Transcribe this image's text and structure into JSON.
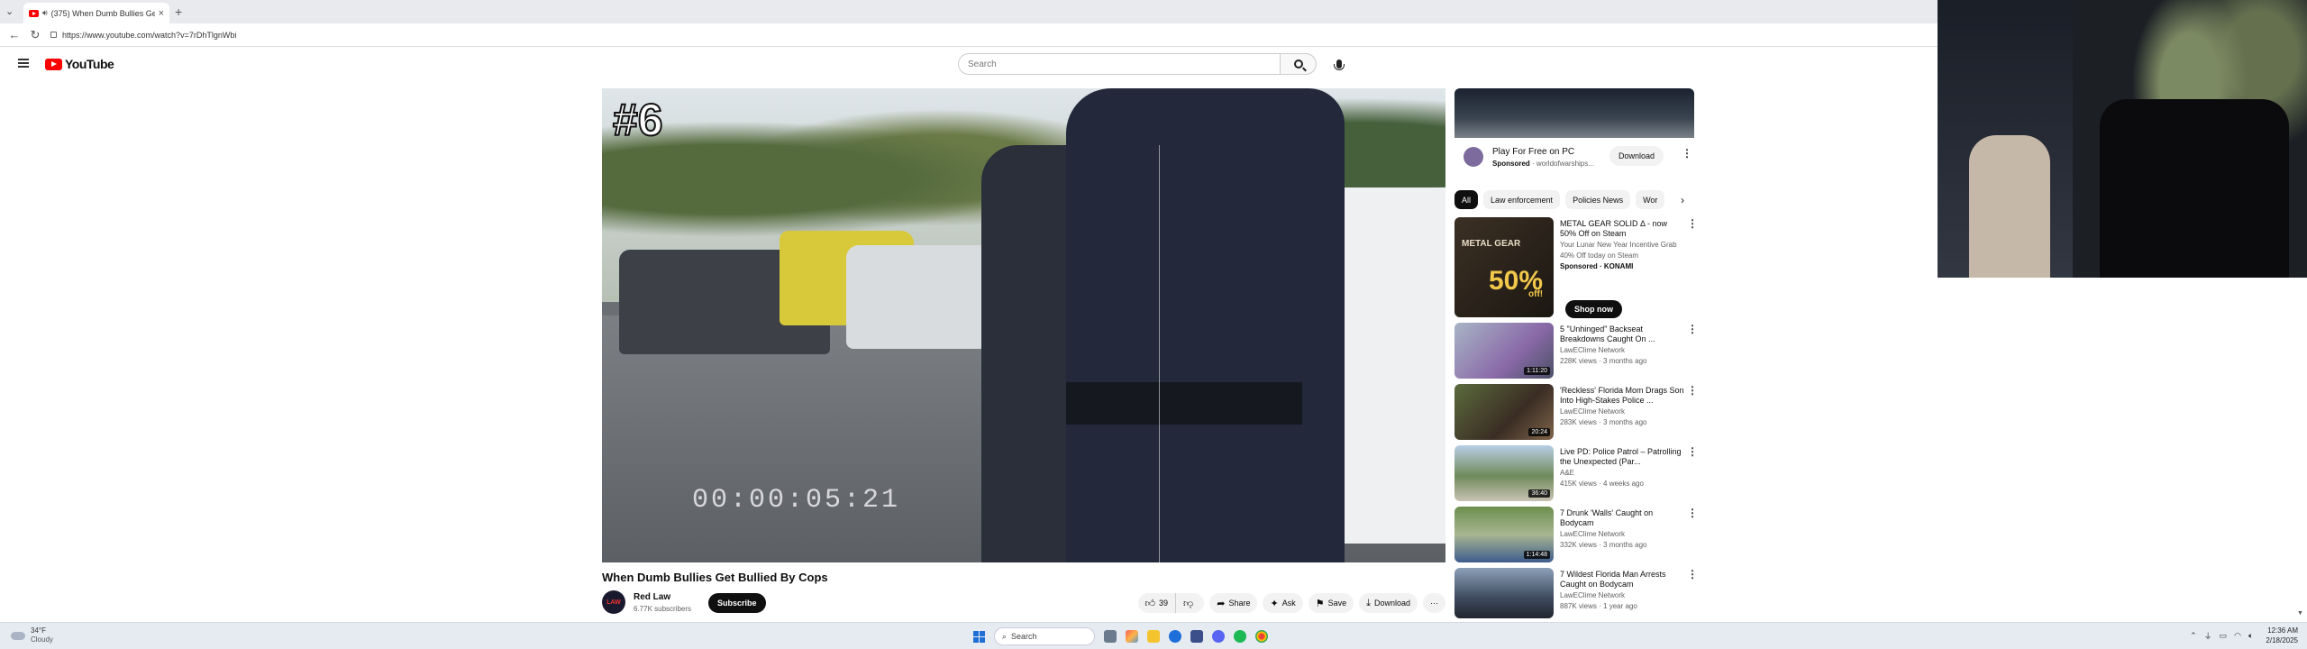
{
  "browser": {
    "tab_title": "(375) When Dumb Bullies Get",
    "new_tab_symbol": "+",
    "close_symbol": "×",
    "url": "https://www.youtube.com/watch?v=7rDhTlgnWbi"
  },
  "youtube": {
    "logo_text": "YouTube",
    "search_placeholder": "Search"
  },
  "video": {
    "overlay_text": "#6",
    "timestamp_text": "00:00:05:21",
    "title": "When Dumb Bullies Get Bullied By Cops",
    "channel_name": "Red Law",
    "channel_avatar_text": "LAW",
    "subscribers": "6.77K subscribers",
    "subscribe_label": "Subscribe",
    "like_count": "39",
    "share_label": "Share",
    "ask_label": "Ask",
    "save_label": "Save",
    "download_label": "Download",
    "more_label": "···"
  },
  "sidebar": {
    "ad": {
      "title": "Play For Free on PC",
      "sponsored": "Sponsored",
      "domain": "· worldofwarships...",
      "download_label": "Download"
    },
    "chips": [
      {
        "label": "All",
        "active": true
      },
      {
        "label": "Law enforcement",
        "active": false
      },
      {
        "label": "Policies News",
        "active": false
      },
      {
        "label": "Wor",
        "active": false
      }
    ],
    "promo": {
      "title": "METAL GEAR SOLID Δ - now 50% Off on Steam",
      "desc1": "Your Lunar New Year Incentive Grab",
      "desc2": "40% Off today on Steam",
      "sponsored": "Sponsored · KONAMI",
      "shop_label": "Shop now",
      "thumb_title": "METAL GEAR",
      "thumb_percent": "50%",
      "thumb_off": "off!"
    },
    "recommendations": [
      {
        "title": "5 \"Unhinged\" Backseat Breakdowns Caught On ...",
        "channel": "LawEClime Network",
        "meta": "228K views · 3 months ago",
        "duration": "1:11:20"
      },
      {
        "title": "'Reckless' Florida Mom Drags Son Into High-Stakes Police ...",
        "channel": "LawEClime Network",
        "meta": "283K views · 3 months ago",
        "duration": "20:24"
      },
      {
        "title": "Live PD: Police Patrol – Patrolling the Unexpected (Par...",
        "channel": "A&E",
        "meta": "415K views · 4 weeks ago",
        "duration": "36:40"
      },
      {
        "title": "7 Drunk 'Walls' Caught on Bodycam",
        "channel": "LawEClime Network",
        "meta": "332K views · 3 months ago",
        "duration": "1:14:48"
      },
      {
        "title": "7 Wildest Florida Man Arrests Caught on Bodycam",
        "channel": "LawEClime Network",
        "meta": "887K views · 1 year ago",
        "duration": ""
      }
    ]
  },
  "taskbar": {
    "temperature": "34°F",
    "condition": "Cloudy",
    "search_label": "Search",
    "time": "12:36 AM",
    "date": "2/18/2025"
  }
}
